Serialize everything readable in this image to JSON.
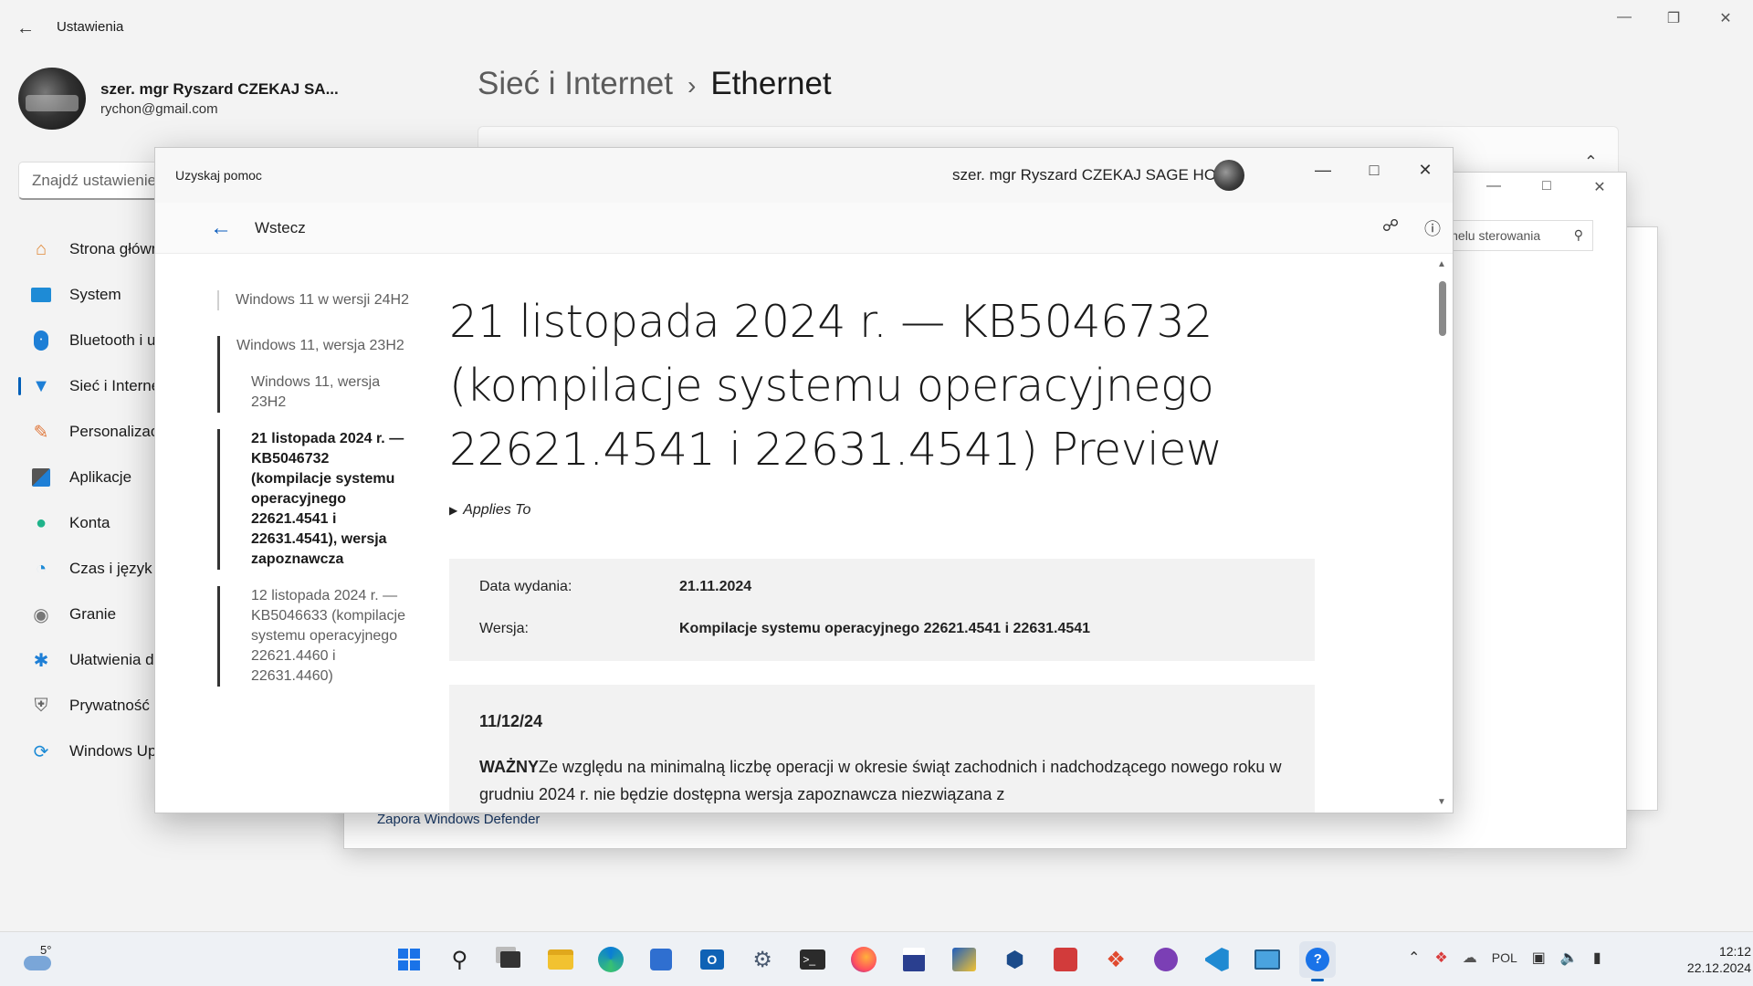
{
  "settings": {
    "window_title": "Ustawienia",
    "profile": {
      "name": "szer. mgr Ryszard CZEKAJ SA...",
      "email": "rychon@gmail.com"
    },
    "search_placeholder": "Znajdź ustawienie",
    "nav": [
      {
        "label": "Strona główna",
        "icon": "home-icon"
      },
      {
        "label": "System",
        "icon": "system-icon"
      },
      {
        "label": "Bluetooth i urządzenia",
        "icon": "bluetooth-icon"
      },
      {
        "label": "Sieć i Internet",
        "icon": "wifi-icon",
        "active": true
      },
      {
        "label": "Personalizacja",
        "icon": "brush-icon"
      },
      {
        "label": "Aplikacje",
        "icon": "apps-icon"
      },
      {
        "label": "Konta",
        "icon": "account-icon"
      },
      {
        "label": "Czas i język",
        "icon": "globe-icon"
      },
      {
        "label": "Granie",
        "icon": "gamepad-icon"
      },
      {
        "label": "Ułatwienia dostępu",
        "icon": "accessibility-icon"
      },
      {
        "label": "Prywatność i zabezpieczenia",
        "icon": "shield-icon"
      },
      {
        "label": "Windows Update",
        "icon": "update-icon"
      }
    ],
    "breadcrumb": {
      "parent": "Sieć i Internet",
      "separator": "›",
      "current": "Ethernet"
    }
  },
  "control_panel": {
    "search_placeholder": "Panelu sterowania",
    "link": "Zapora Windows Defender"
  },
  "help": {
    "window_title": "Uzyskaj pomoc",
    "user": "szer. mgr Ryszard CZEKAJ SAGE HO",
    "back_label": "Wstecz",
    "toc": {
      "item1": "Windows 11 w wersji 24H2",
      "item2": "Windows 11, wersja 23H2",
      "sub1": "Windows 11, wersja 23H2",
      "sub2": "21 listopada 2024 r. — KB5046732 (kompilacje systemu operacyjnego 22621.4541 i 22631.4541), wersja zapoznawcza",
      "sub3": "12 listopada 2024 r. — KB5046633 (kompilacje systemu operacyjnego 22621.4460 i 22631.4460)"
    },
    "article": {
      "title": "21 listopada 2024 r. — KB5046732 (kompilacje systemu operacyjnego 22621.4541 i 22631.4541) Preview",
      "applies_to": "Applies To",
      "release_date_label": "Data wydania:",
      "release_date_value": "21.11.2024",
      "version_label": "Wersja:",
      "version_value": "Kompilacje systemu operacyjnego 22621.4541 i 22631.4541",
      "note_date": "11/12/24",
      "note_bold": "WAŻNY",
      "note_text": "Ze względu na minimalną liczbę operacji w okresie świąt zachodnich i nadchodzącego nowego roku w grudniu 2024 r. nie będzie dostępna wersja zapoznawcza niezwiązana z"
    }
  },
  "taskbar": {
    "weather_temp": "5°",
    "apps": [
      "start-icon",
      "search-icon",
      "task-view-icon",
      "file-explorer-icon",
      "edge-icon",
      "store-icon",
      "outlook-icon",
      "settings-icon",
      "terminal-icon",
      "firefox-icon",
      "save-disk-icon",
      "dev-tool-icon",
      "virtualbox-icon",
      "media-icon",
      "git-icon",
      "github-icon",
      "vscode-icon",
      "remote-icon",
      "get-help-icon"
    ],
    "language": "POL",
    "time": "12:12",
    "date": "22.12.2024"
  }
}
